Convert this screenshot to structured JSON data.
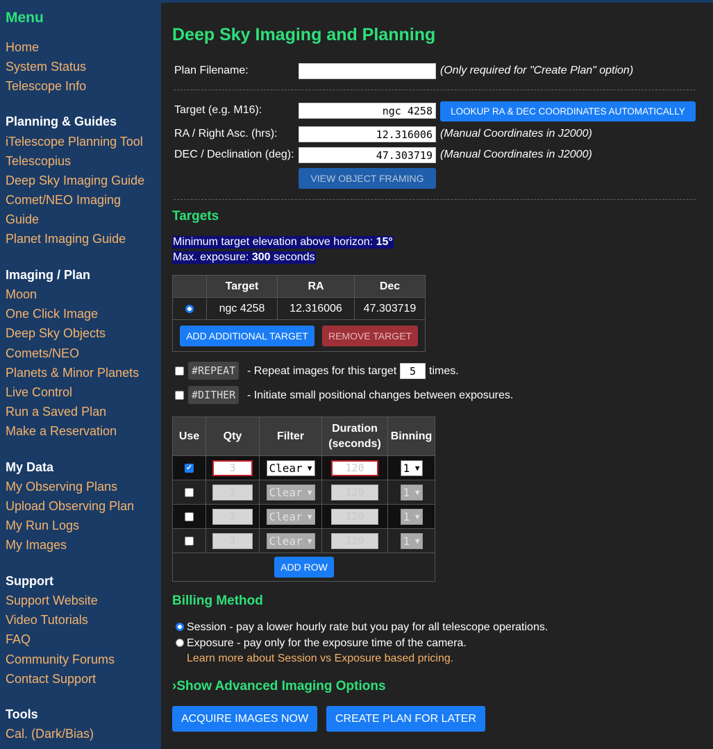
{
  "sidebar": {
    "menu_title": "Menu",
    "top_links": [
      "Home",
      "System Status",
      "Telescope Info"
    ],
    "planning_heading": "Planning & Guides",
    "planning_links": [
      "iTelescope Planning Tool",
      "Telescopius",
      "Deep Sky Imaging Guide",
      "Comet/NEO Imaging",
      "Guide",
      "Planet Imaging Guide"
    ],
    "imaging_heading": "Imaging / Plan",
    "imaging_links": [
      "Moon",
      "One Click Image",
      "Deep Sky Objects",
      "Comets/NEO",
      "Planets & Minor Planets",
      "Live Control",
      "Run a Saved Plan",
      "Make a Reservation"
    ],
    "mydata_heading": "My Data",
    "mydata_links": [
      "My Observing Plans",
      "Upload Observing Plan",
      "My Run Logs",
      "My Images"
    ],
    "support_heading": "Support",
    "support_links": [
      "Support Website",
      "Video Tutorials",
      "FAQ",
      "Community Forums",
      "Contact Support"
    ],
    "tools_heading": "Tools",
    "tools_links": [
      "Cal. (Dark/Bias)"
    ]
  },
  "main": {
    "title": "Deep Sky Imaging and Planning",
    "plan_filename_label": "Plan Filename:",
    "plan_filename_value": "",
    "plan_filename_note": "(Only required for \"Create Plan\" option)",
    "target_label": "Target (e.g. M16):",
    "target_value": "ngc 4258",
    "lookup_button": "LOOKUP RA & DEC COORDINATES AUTOMATICALLY",
    "ra_label": "RA / Right Asc. (hrs):",
    "ra_value": "12.316006",
    "ra_note": "(Manual Coordinates in J2000)",
    "dec_label": "DEC / Declination (deg):",
    "dec_value": "47.303719",
    "dec_note": "(Manual Coordinates in J2000)",
    "view_framing_button": "VIEW OBJECT FRAMING",
    "targets_heading": "Targets",
    "min_elev_text": "Minimum target elevation above horizon: ",
    "min_elev_value": "15°",
    "max_exp_text": "Max. exposure: ",
    "max_exp_value": "300",
    "max_exp_unit": " seconds",
    "targets_table": {
      "headers": [
        "Target",
        "RA",
        "Dec"
      ],
      "rows": [
        {
          "selected": true,
          "target": "ngc 4258",
          "ra": "12.316006",
          "dec": "47.303719"
        }
      ]
    },
    "add_target_button": "ADD ADDITIONAL TARGET",
    "remove_target_button": "REMOVE TARGET",
    "repeat_tag": "#REPEAT",
    "repeat_text": "- Repeat images for this target",
    "repeat_value": "5",
    "repeat_suffix": "times.",
    "dither_tag": "#DITHER",
    "dither_text": "- Initiate small positional changes between exposures.",
    "exposure_table": {
      "headers": [
        "Use",
        "Qty",
        "Filter",
        "Duration (seconds)",
        "Binning"
      ],
      "rows": [
        {
          "use": true,
          "qty": "3",
          "filter": "Clear",
          "duration": "120",
          "binning": "1"
        },
        {
          "use": false,
          "qty": "3",
          "filter": "Clear",
          "duration": "120",
          "binning": "1"
        },
        {
          "use": false,
          "qty": "3",
          "filter": "Clear",
          "duration": "120",
          "binning": "1"
        },
        {
          "use": false,
          "qty": "3",
          "filter": "Clear",
          "duration": "120",
          "binning": "1"
        }
      ]
    },
    "add_row_button": "ADD ROW",
    "billing_heading": "Billing Method",
    "session_option": "Session - pay a lower hourly rate but you pay for all telescope operations.",
    "exposure_option": "Exposure - pay only for the exposure time of the camera.",
    "pricing_link": "Learn more about Session vs Exposure based pricing.",
    "advanced_toggle": "Show Advanced Imaging Options",
    "acquire_button": "ACQUIRE IMAGES NOW",
    "create_plan_button": "CREATE PLAN FOR LATER"
  },
  "colors": {
    "accent_green": "#2ee07a",
    "link_orange": "#f6b36b",
    "sidebar_bg": "#1a3b66",
    "main_bg": "#222222",
    "button_blue": "#1a7cf5"
  }
}
